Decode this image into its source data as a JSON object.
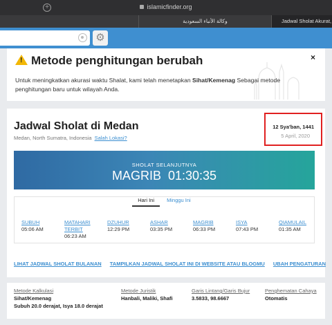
{
  "browser": {
    "url": "islamicfinder.org",
    "tabs": [
      {
        "label": ""
      },
      {
        "label": "وكالة الأنباء السعودية"
      },
      {
        "label": "Jadwal Sholat Akurat, Q"
      }
    ]
  },
  "notice": {
    "title": "Metode penghitungan berubah",
    "body_pre": "Untuk meningkatkan akurasi waktu Shalat, kami telah menetapkan ",
    "body_bold": "Sihat/Kemenag",
    "body_post": " Sebagai metode penghitungan baru untuk wilayah Anda.",
    "close": "×"
  },
  "schedule": {
    "title": "Jadwal Sholat di Medan",
    "location": "Medan, North Sumatra, Indonesia",
    "change_location": "Salah Lokasi?",
    "hijri_date": "12 Sya'ban, 1441",
    "greg_date": "5 April, 2020",
    "next_label": "SHOLAT SELANJUTNYA",
    "next_name": "MAGRIB",
    "next_countdown": "01:30:35",
    "tab_today": "Hari Ini",
    "tab_week": "Minggu Ini",
    "prayers": [
      {
        "name": "SUBUH",
        "time": "05:06 AM"
      },
      {
        "name": "MATAHARI TERBIT",
        "time": "06:23 AM"
      },
      {
        "name": "DZUHUR",
        "time": "12:29 PM"
      },
      {
        "name": "ASHAR",
        "time": "03:35 PM"
      },
      {
        "name": "MAGRIB",
        "time": "06:33 PM"
      },
      {
        "name": "ISYA",
        "time": "07:43 PM"
      },
      {
        "name": "QIAMULAIL",
        "time": "01:35 AM"
      }
    ],
    "links": [
      "LIHAT JADWAL SHOLAT BULANAN",
      "TAMPILKAN JADWAL SHOLAT INI DI WEBSITE ATAU BLOGMU",
      "UBAH PENGATURAN"
    ]
  },
  "info": {
    "method_label": "Metode Kalkulasi",
    "method_value": "Sihat/Kemenag",
    "method_detail": "Subuh 20.0 derajat, Isya 18.0 derajat",
    "juristic_label": "Metode Juristik",
    "juristic_value": "Hanbali, Maliki, Shafi",
    "coords_label": "Garis Lintang/Garis Bujur",
    "coords_value": "3.5833, 98.6667",
    "dst_label": "Penghematan Cahaya",
    "dst_value": "Otomatis"
  },
  "colors": {
    "accent": "#3b8ed0",
    "toolbar": "#3f8fd0",
    "highlight_box": "#e02020",
    "banner_start": "#2f6aa3",
    "banner_end": "#25a59b"
  }
}
